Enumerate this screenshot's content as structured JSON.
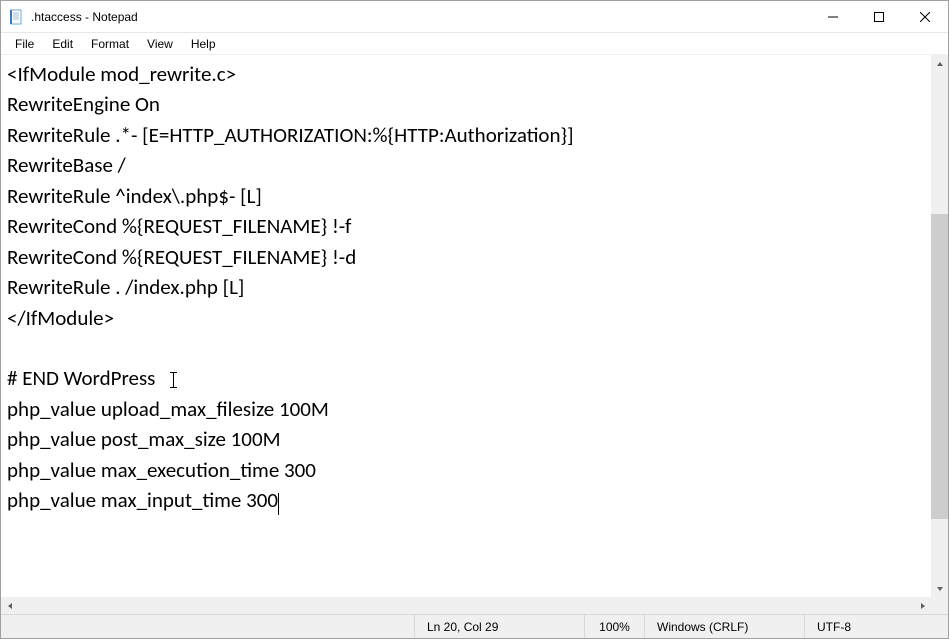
{
  "window": {
    "title": ".htaccess - Notepad"
  },
  "menu": {
    "file": "File",
    "edit": "Edit",
    "format": "Format",
    "view": "View",
    "help": "Help"
  },
  "editor": {
    "lines": [
      "<IfModule mod_rewrite.c>",
      "RewriteEngine On",
      "RewriteRule .*- [E=HTTP_AUTHORIZATION:%{HTTP:Authorization}]",
      "RewriteBase /",
      "RewriteRule ^index\\.php$- [L]",
      "RewriteCond %{REQUEST_FILENAME} !-f",
      "RewriteCond %{REQUEST_FILENAME} !-d",
      "RewriteRule . /index.php [L]",
      "</IfModule>",
      "",
      "# END WordPress",
      "php_value upload_max_filesize 100M",
      "php_value post_max_size 100M",
      "php_value max_execution_time 300",
      "php_value max_input_time 300"
    ],
    "caret_line_index": 14,
    "ibeam_line_index": 10
  },
  "status": {
    "position": "Ln 20, Col 29",
    "zoom": "100%",
    "line_ending": "Windows (CRLF)",
    "encoding": "UTF-8"
  }
}
